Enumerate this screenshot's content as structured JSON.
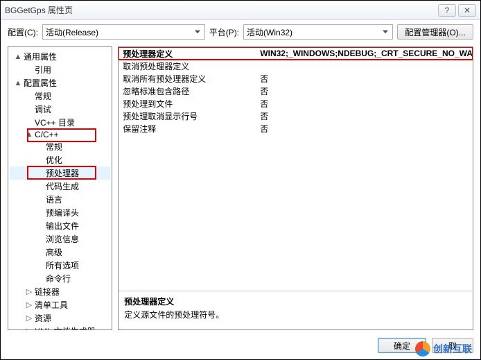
{
  "window": {
    "title": "BGGetGps 属性页",
    "help": "?",
    "close": "✕"
  },
  "toolbar": {
    "config_label": "配置(C):",
    "config_value": "活动(Release)",
    "platform_label": "平台(P):",
    "platform_value": "活动(Win32)",
    "manager_button": "配置管理器(O)..."
  },
  "tree": [
    {
      "label": "通用属性",
      "level": 0,
      "expander": "▲"
    },
    {
      "label": "引用",
      "level": 1,
      "expander": ""
    },
    {
      "label": "配置属性",
      "level": 0,
      "expander": "▲"
    },
    {
      "label": "常规",
      "level": 1,
      "expander": ""
    },
    {
      "label": "调试",
      "level": 1,
      "expander": ""
    },
    {
      "label": "VC++ 目录",
      "level": 1,
      "expander": ""
    },
    {
      "label": "C/C++",
      "level": 1,
      "expander": "▲",
      "red": true
    },
    {
      "label": "常规",
      "level": 2,
      "expander": ""
    },
    {
      "label": "优化",
      "level": 2,
      "expander": ""
    },
    {
      "label": "预处理器",
      "level": 2,
      "expander": "",
      "selected": true,
      "red": true
    },
    {
      "label": "代码生成",
      "level": 2,
      "expander": ""
    },
    {
      "label": "语言",
      "level": 2,
      "expander": ""
    },
    {
      "label": "预编译头",
      "level": 2,
      "expander": ""
    },
    {
      "label": "输出文件",
      "level": 2,
      "expander": ""
    },
    {
      "label": "浏览信息",
      "level": 2,
      "expander": ""
    },
    {
      "label": "高级",
      "level": 2,
      "expander": ""
    },
    {
      "label": "所有选项",
      "level": 2,
      "expander": ""
    },
    {
      "label": "命令行",
      "level": 2,
      "expander": ""
    },
    {
      "label": "链接器",
      "level": 1,
      "expander": "▷"
    },
    {
      "label": "清单工具",
      "level": 1,
      "expander": "▷"
    },
    {
      "label": "资源",
      "level": 1,
      "expander": "▷"
    },
    {
      "label": "XML 文档生成器",
      "level": 1,
      "expander": "▷"
    }
  ],
  "grid": [
    {
      "label": "预处理器定义",
      "value": "WIN32;_WINDOWS;NDEBUG;_CRT_SECURE_NO_WA",
      "hl": true
    },
    {
      "label": "取消预处理器定义",
      "value": ""
    },
    {
      "label": "取消所有预处理器定义",
      "value": "否"
    },
    {
      "label": "忽略标准包含路径",
      "value": "否"
    },
    {
      "label": "预处理到文件",
      "value": "否"
    },
    {
      "label": "预处理取消显示行号",
      "value": "否"
    },
    {
      "label": "保留注释",
      "value": "否"
    }
  ],
  "desc": {
    "title": "预处理器定义",
    "body": "定义源文件的预处理符号。"
  },
  "footer": {
    "ok": "确定",
    "cancel": "取"
  },
  "watermark": "创新互联"
}
